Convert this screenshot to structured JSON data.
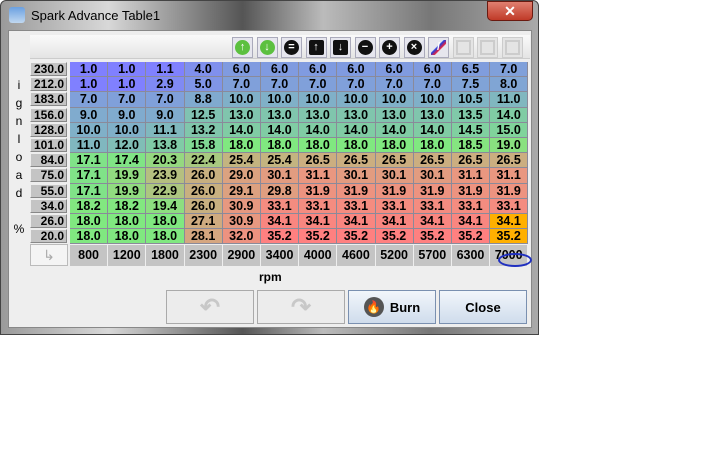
{
  "window": {
    "title": "Spark Advance Table1",
    "close_glyph": "✕"
  },
  "y_axis_label": [
    "i",
    "g",
    "n",
    "l",
    "o",
    "a",
    "d",
    "",
    "%"
  ],
  "x_axis_label": "rpm",
  "toolbar": [
    {
      "name": "increment-green-icon",
      "glyph": "↑",
      "style": "g"
    },
    {
      "name": "decrement-green-icon",
      "glyph": "↓",
      "style": "g"
    },
    {
      "name": "set-equal-icon",
      "glyph": "=",
      "style": ""
    },
    {
      "name": "arrow-up-icon",
      "glyph": "↑",
      "style": "sq"
    },
    {
      "name": "arrow-down-icon",
      "glyph": "↓",
      "style": "sq"
    },
    {
      "name": "minus-icon",
      "glyph": "−",
      "style": ""
    },
    {
      "name": "plus-icon",
      "glyph": "+",
      "style": ""
    },
    {
      "name": "multiply-icon",
      "glyph": "×",
      "style": ""
    },
    {
      "name": "pencil-icon",
      "glyph": "/",
      "style": "pen"
    },
    {
      "name": "rows-icon",
      "glyph": "",
      "style": "dis"
    },
    {
      "name": "columns-icon",
      "glyph": "",
      "style": "dis"
    },
    {
      "name": "block-icon",
      "glyph": "",
      "style": "dis"
    }
  ],
  "table": {
    "y_values": [
      "230.0",
      "212.0",
      "183.0",
      "156.0",
      "128.0",
      "101.0",
      "84.0",
      "75.0",
      "55.0",
      "34.0",
      "26.0",
      "20.0"
    ],
    "x_values": [
      "800",
      "1200",
      "1800",
      "2300",
      "2900",
      "3400",
      "4000",
      "4600",
      "5200",
      "5700",
      "6300",
      "7000"
    ],
    "cells": [
      [
        "1.0",
        "1.0",
        "1.1",
        "4.0",
        "6.0",
        "6.0",
        "6.0",
        "6.0",
        "6.0",
        "6.0",
        "6.5",
        "7.0"
      ],
      [
        "1.0",
        "1.0",
        "2.9",
        "5.0",
        "7.0",
        "7.0",
        "7.0",
        "7.0",
        "7.0",
        "7.0",
        "7.5",
        "8.0"
      ],
      [
        "7.0",
        "7.0",
        "7.0",
        "8.8",
        "10.0",
        "10.0",
        "10.0",
        "10.0",
        "10.0",
        "10.0",
        "10.5",
        "11.0"
      ],
      [
        "9.0",
        "9.0",
        "9.0",
        "12.5",
        "13.0",
        "13.0",
        "13.0",
        "13.0",
        "13.0",
        "13.0",
        "13.5",
        "14.0"
      ],
      [
        "10.0",
        "10.0",
        "11.1",
        "13.2",
        "14.0",
        "14.0",
        "14.0",
        "14.0",
        "14.0",
        "14.0",
        "14.5",
        "15.0"
      ],
      [
        "11.0",
        "12.0",
        "13.8",
        "15.8",
        "18.0",
        "18.0",
        "18.0",
        "18.0",
        "18.0",
        "18.0",
        "18.5",
        "19.0"
      ],
      [
        "17.1",
        "17.4",
        "20.3",
        "22.4",
        "25.4",
        "25.4",
        "26.5",
        "26.5",
        "26.5",
        "26.5",
        "26.5",
        "26.5"
      ],
      [
        "17.1",
        "19.9",
        "23.9",
        "26.0",
        "29.0",
        "30.1",
        "31.1",
        "30.1",
        "30.1",
        "30.1",
        "31.1",
        "31.1"
      ],
      [
        "17.1",
        "19.9",
        "22.9",
        "26.0",
        "29.1",
        "29.8",
        "31.9",
        "31.9",
        "31.9",
        "31.9",
        "31.9",
        "31.9"
      ],
      [
        "18.2",
        "18.2",
        "19.4",
        "26.0",
        "30.9",
        "33.1",
        "33.1",
        "33.1",
        "33.1",
        "33.1",
        "33.1",
        "33.1"
      ],
      [
        "18.0",
        "18.0",
        "18.0",
        "27.1",
        "30.9",
        "34.1",
        "34.1",
        "34.1",
        "34.1",
        "34.1",
        "34.1",
        "34.1"
      ],
      [
        "18.0",
        "18.0",
        "18.0",
        "28.1",
        "32.0",
        "35.2",
        "35.2",
        "35.2",
        "35.2",
        "35.2",
        "35.2",
        "35.2"
      ]
    ],
    "selected_cells": [
      [
        10,
        11
      ],
      [
        11,
        11
      ]
    ],
    "selected_color": "#ffb000"
  },
  "buttons": {
    "undo": "↶",
    "redo": "↷",
    "burn": "Burn",
    "close": "Close"
  }
}
